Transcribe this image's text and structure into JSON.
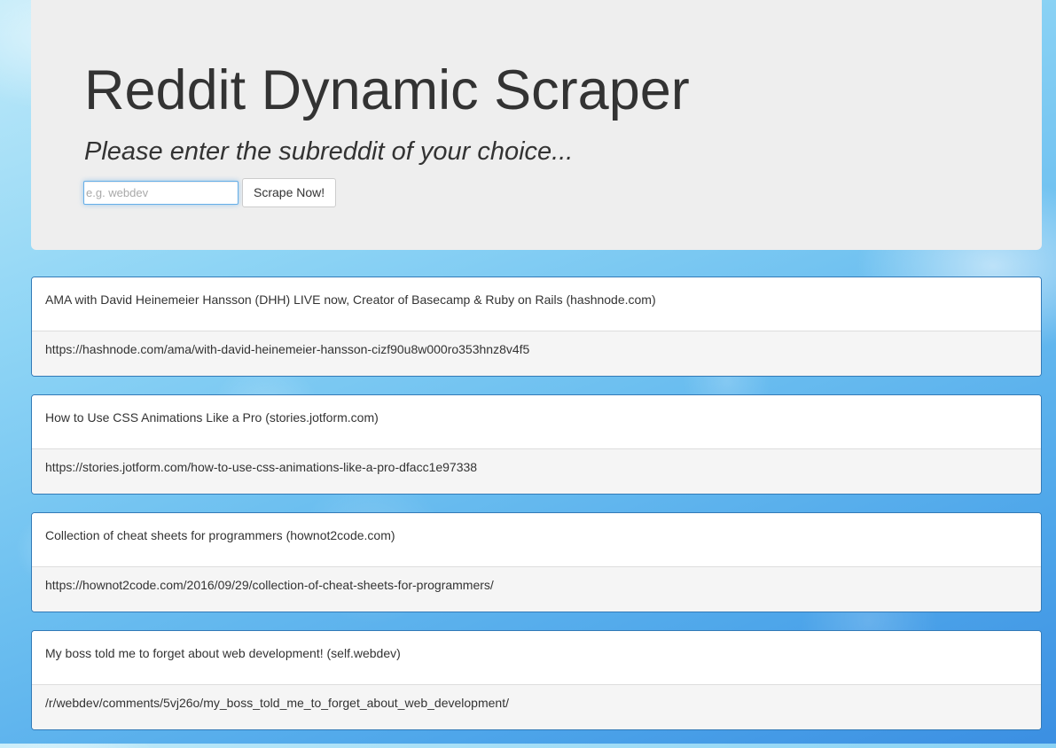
{
  "header": {
    "title": "Reddit Dynamic Scraper",
    "subtitle": "Please enter the subreddit of your choice...",
    "input_placeholder": "e.g. webdev",
    "input_value": "",
    "button_label": "Scrape Now!"
  },
  "posts": [
    {
      "title": "AMA with David Heinemeier Hansson (DHH) LIVE now, Creator of Basecamp & Ruby on Rails (hashnode.com)",
      "url": "https://hashnode.com/ama/with-david-heinemeier-hansson-cizf90u8w000ro353hnz8v4f5"
    },
    {
      "title": "How to Use CSS Animations Like a Pro (stories.jotform.com)",
      "url": "https://stories.jotform.com/how-to-use-css-animations-like-a-pro-dfacc1e97338"
    },
    {
      "title": "Collection of cheat sheets for programmers (hownot2code.com)",
      "url": "https://hownot2code.com/2016/09/29/collection-of-cheat-sheets-for-programmers/"
    },
    {
      "title": "My boss told me to forget about web development! (self.webdev)",
      "url": "/r/webdev/comments/5vj26o/my_boss_told_me_to_forget_about_web_development/"
    }
  ],
  "colors": {
    "jumbotron_bg": "#eeeeee",
    "panel_border": "#337ab7",
    "panel_footer_bg": "#f5f5f5",
    "input_focus_border": "#66afe9"
  }
}
